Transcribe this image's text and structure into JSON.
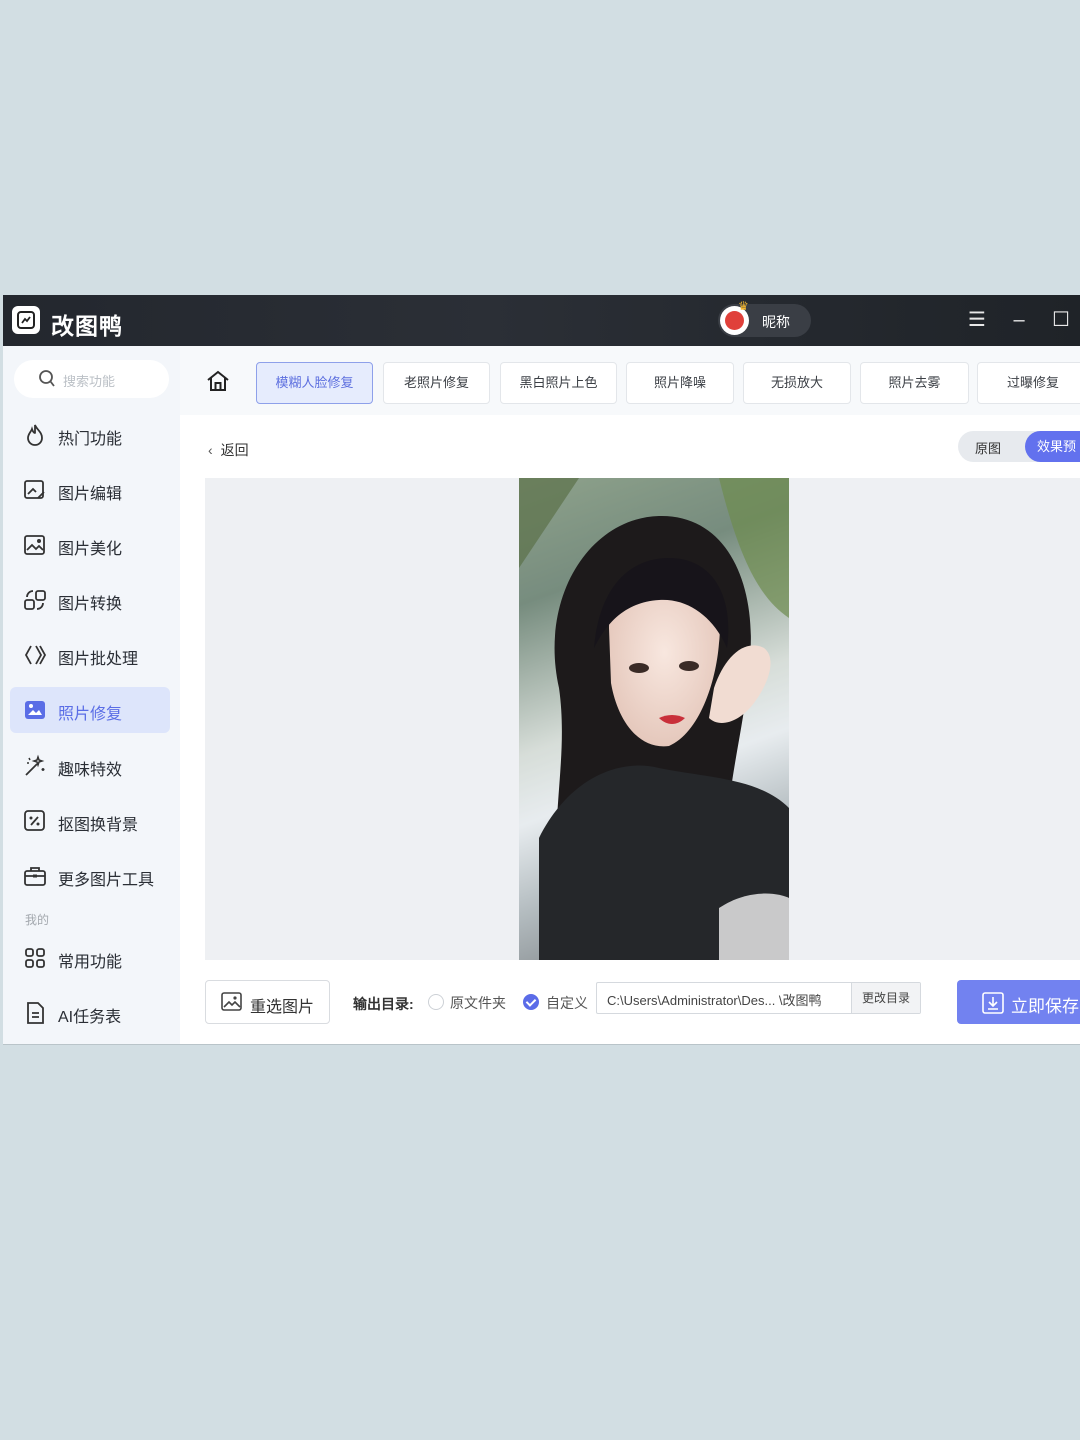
{
  "app": {
    "name": "改图鸭"
  },
  "user": {
    "nickname": "昵称"
  },
  "search": {
    "placeholder": "搜索功能"
  },
  "sidebar": {
    "items": [
      {
        "label": "热门功能",
        "icon": "flame-icon"
      },
      {
        "label": "图片编辑",
        "icon": "image-edit-icon"
      },
      {
        "label": "图片美化",
        "icon": "image-beautify-icon"
      },
      {
        "label": "图片转换",
        "icon": "convert-icon"
      },
      {
        "label": "图片批处理",
        "icon": "batch-icon"
      },
      {
        "label": "照片修复",
        "icon": "photo-repair-icon",
        "active": true
      },
      {
        "label": "趣味特效",
        "icon": "magic-wand-icon"
      },
      {
        "label": "抠图换背景",
        "icon": "cutout-icon"
      },
      {
        "label": "更多图片工具",
        "icon": "toolbox-icon"
      }
    ],
    "section_mine": "我的",
    "mine_items": [
      {
        "label": "常用功能",
        "icon": "grid-icon"
      },
      {
        "label": "AI任务表",
        "icon": "document-icon"
      }
    ]
  },
  "tabs": [
    {
      "label": "模糊人脸修复",
      "active": true
    },
    {
      "label": "老照片修复"
    },
    {
      "label": "黑白照片上色"
    },
    {
      "label": "照片降噪"
    },
    {
      "label": "无损放大"
    },
    {
      "label": "照片去雾"
    },
    {
      "label": "过曝修复"
    }
  ],
  "content": {
    "back_label": "返回",
    "toggle_original": "原图",
    "toggle_effect": "效果预",
    "reselect_label": "重选图片",
    "output_label": "输出目录:",
    "radio_original": "原文件夹",
    "radio_custom": "自定义",
    "path_value": "C:\\Users\\Administrator\\Des... \\改图鸭",
    "change_dir": "更改目录",
    "save_label": "立即保存"
  },
  "colors": {
    "accent": "#6271ee",
    "titlebar": "#23272e",
    "active_nav_bg": "#dde5fb"
  }
}
